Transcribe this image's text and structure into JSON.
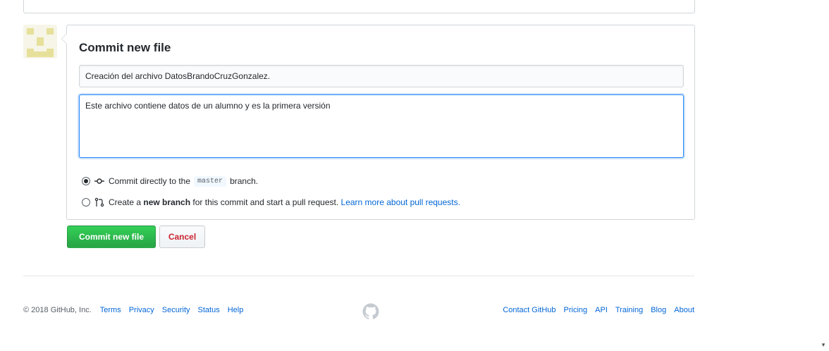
{
  "commit_form": {
    "title": "Commit new file",
    "summary_value": "Creación del archivo DatosBrandoCruzGonzalez.",
    "description_value": "Este archivo contiene datos de un alumno y es la primera versión",
    "option_direct": {
      "prefix": "Commit directly to the",
      "branch": "master",
      "suffix": "branch."
    },
    "option_new_branch": {
      "prefix": "Create a",
      "strong": "new branch",
      "middle": "for this commit and start a pull request.",
      "link": "Learn more about pull requests."
    },
    "commit_button": "Commit new file",
    "cancel_button": "Cancel"
  },
  "footer": {
    "copyright": "© 2018 GitHub, Inc.",
    "left_links": [
      "Terms",
      "Privacy",
      "Security",
      "Status",
      "Help"
    ],
    "right_links": [
      "Contact GitHub",
      "Pricing",
      "API",
      "Training",
      "Blog",
      "About"
    ]
  },
  "colors": {
    "accent": "#0366d6",
    "commit_button": "#28a745",
    "cancel_text": "#cb2431",
    "avatar": "#e6e09a"
  },
  "icons": {
    "commit": "git-commit-icon",
    "pull_request": "git-pull-request-icon",
    "footer_mark": "github-mark-icon"
  }
}
